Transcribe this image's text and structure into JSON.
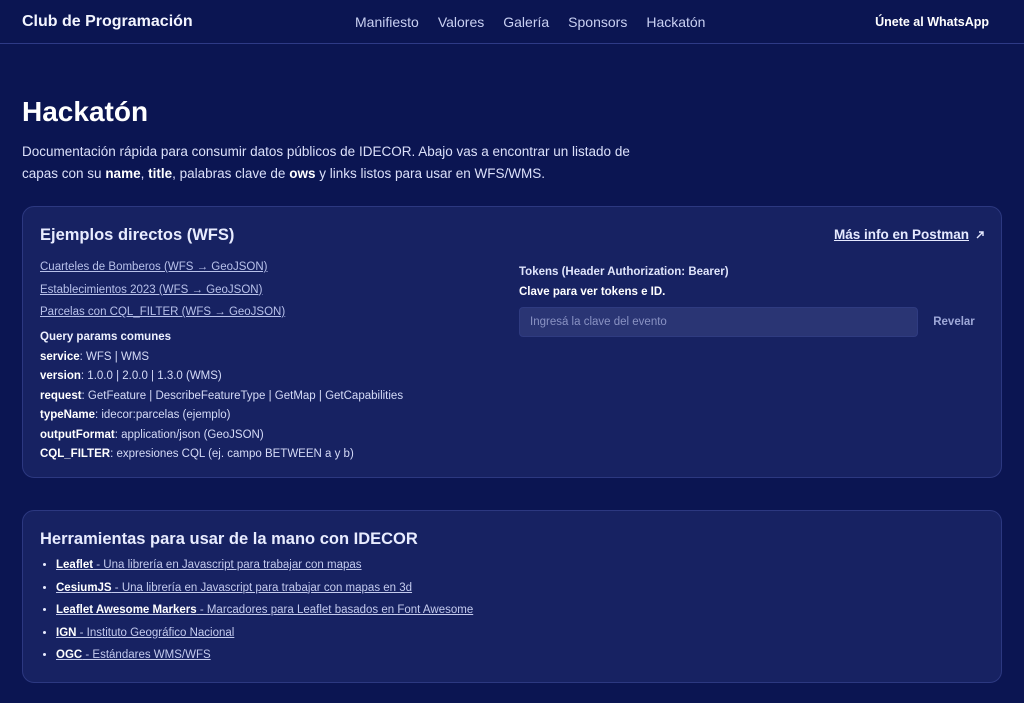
{
  "nav": {
    "brand": "Club de Programación",
    "links": [
      "Manifiesto",
      "Valores",
      "Galería",
      "Sponsors",
      "Hackatón"
    ],
    "whatsapp": "Únete al WhatsApp"
  },
  "page": {
    "title": "Hackatón",
    "intro": {
      "p1": "Documentación rápida para consumir datos públicos de IDECOR. Abajo vas a encontrar un listado de capas con su ",
      "b1": "name",
      "p2": ", ",
      "b2": "title",
      "p3": ", palabras clave de ",
      "b3": "ows",
      "p4": " y links listos para usar en WFS/WMS."
    }
  },
  "wfs_card": {
    "title": "Ejemplos directos (WFS)",
    "postman": "Más info en Postman",
    "examples": [
      "Cuarteles de Bomberos (WFS → GeoJSON)",
      "Establecimientos 2023 (WFS → GeoJSON)",
      "Parcelas con CQL_FILTER (WFS → GeoJSON)"
    ],
    "query_title": "Query params comunes",
    "query_params": [
      {
        "key": "service",
        "value": ": WFS | WMS"
      },
      {
        "key": "version",
        "value": ": 1.0.0 | 2.0.0 | 1.3.0 (WMS)"
      },
      {
        "key": "request",
        "value": ": GetFeature | DescribeFeatureType | GetMap | GetCapabilities"
      },
      {
        "key": "typeName",
        "value": ": idecor:parcelas (ejemplo)"
      },
      {
        "key": "outputFormat",
        "value": ": application/json (GeoJSON)"
      },
      {
        "key": "CQL_FILTER",
        "value": ": expresiones CQL (ej. campo BETWEEN a y b)"
      }
    ],
    "tokens": {
      "title": "Tokens (Header Authorization: Bearer)",
      "subtitle": "Clave para ver tokens e ID.",
      "placeholder": "Ingresá la clave del evento",
      "value": "",
      "reveal": "Revelar"
    }
  },
  "tools_card": {
    "title": "Herramientas para usar de la mano con IDECOR",
    "items": [
      {
        "name": "Leaflet",
        "desc": " - Una librería en Javascript para trabajar con mapas"
      },
      {
        "name": "CesiumJS",
        "desc": " - Una librería en Javascript para trabajar con mapas en 3d"
      },
      {
        "name": "Leaflet Awesome Markers",
        "desc": " - Marcadores para Leaflet basados en Font Awesome"
      },
      {
        "name": "IGN",
        "desc": " - Instituto Geográfico Nacional"
      },
      {
        "name": "OGC",
        "desc": " - Estándares WMS/WFS"
      }
    ]
  }
}
